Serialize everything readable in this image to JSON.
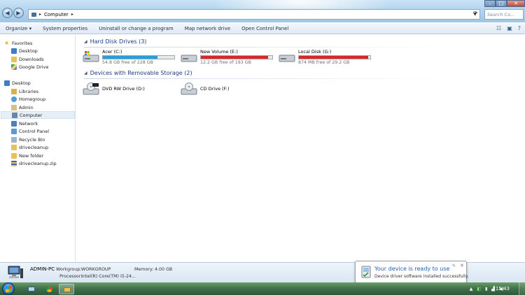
{
  "address": {
    "breadcrumb": "Computer",
    "search_placeholder": "Search Co..."
  },
  "toolbar": {
    "items": [
      "Organize",
      "System properties",
      "Uninstall or change a program",
      "Map network drive",
      "Open Control Panel"
    ]
  },
  "nav": {
    "favorites": "Favorites",
    "fav_items": [
      "Desktop",
      "Downloads",
      "Google Drive"
    ],
    "tree": [
      "Desktop",
      "Libraries",
      "Homegroup",
      "Admin",
      "Computer",
      "Network",
      "Control Panel",
      "Recycle Bin",
      "drivecleanup",
      "New folder",
      "drivecleanup.zip"
    ],
    "selected": "Computer"
  },
  "groups": {
    "hard": "Hard Disk Drives (3)",
    "removable": "Devices with Removable Storage (2)"
  },
  "drives": [
    {
      "name": "Acer (C:)",
      "free": "54.8 GB free of 228 GB",
      "used_fraction": 0.76,
      "color": "#26a0da"
    },
    {
      "name": "New Volume (E:)",
      "free": "12.2 GB free of 193 GB",
      "used_fraction": 0.94,
      "color": "#da2626"
    },
    {
      "name": "Local Disk (G:)",
      "free": "874 MB free of 29.2 GB",
      "used_fraction": 0.97,
      "color": "#da2626"
    }
  ],
  "removable": [
    {
      "name": "DVD RW Drive (D:)"
    },
    {
      "name": "CD Drive (F:)"
    }
  ],
  "details": {
    "pc_name": "ADMIN-PC",
    "workgroup_label": "Workgroup:",
    "workgroup": "WORKGROUP",
    "memory_label": "Memory:",
    "memory": "4.00 GB",
    "processor_label": "Processor:",
    "processor": "Intel(R) Core(TM) i5-24..."
  },
  "balloon": {
    "title": "Your device is ready to use",
    "body": "Device driver software installed successfully."
  },
  "taskbar": {
    "clock": "15:43"
  }
}
